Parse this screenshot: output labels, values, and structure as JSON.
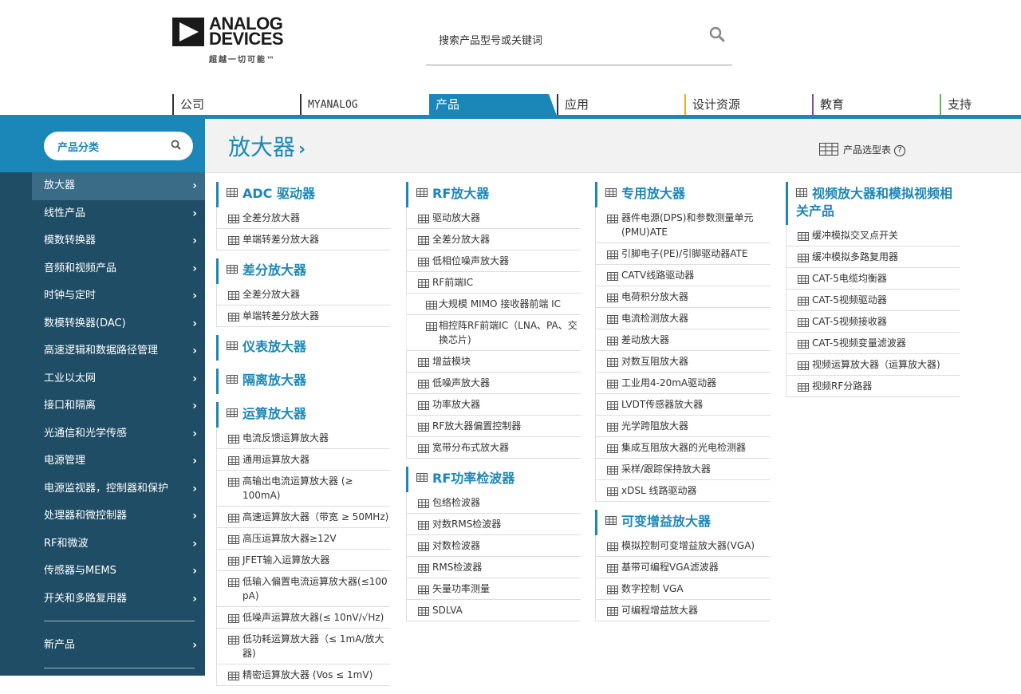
{
  "brand": {
    "line1": "ANALOG",
    "line2": "DEVICES",
    "tagline": "超越一切可能™"
  },
  "search": {
    "placeholder": "搜索产品型号或关键词"
  },
  "topnav": [
    {
      "label": "公司",
      "color": "#333333"
    },
    {
      "label": "MYANALOG",
      "color": "#333333"
    },
    {
      "label": "产品",
      "color": "#1b87b8",
      "active": true
    },
    {
      "label": "应用",
      "color": "#333333"
    },
    {
      "label": "设计资源",
      "color": "#f5a623"
    },
    {
      "label": "教育",
      "color": "#7b4fa0"
    },
    {
      "label": "支持",
      "color": "#5cb85c"
    }
  ],
  "sidebar": {
    "category_label": "产品分类",
    "items": [
      {
        "label": "放大器",
        "active": true
      },
      {
        "label": "线性产品"
      },
      {
        "label": "模数转换器"
      },
      {
        "label": "音频和视频产品"
      },
      {
        "label": "时钟与定时"
      },
      {
        "label": "数模转换器(DAC)"
      },
      {
        "label": "高速逻辑和数据路径管理"
      },
      {
        "label": "工业以太网"
      },
      {
        "label": "接口和隔离"
      },
      {
        "label": "光通信和光学传感"
      },
      {
        "label": "电源管理"
      },
      {
        "label": "电源监视器，控制器和保护"
      },
      {
        "label": "处理器和微控制器"
      },
      {
        "label": "RF和微波"
      },
      {
        "label": "传感器与MEMS"
      },
      {
        "label": "开关和多路复用器"
      }
    ],
    "new_products": "新产品"
  },
  "main": {
    "title": "放大器",
    "selector_label": "产品选型表",
    "help_glyph": "?",
    "columns": [
      [
        {
          "title": "ADC 驱动器",
          "items": [
            "全差分放大器",
            "单端转差分放大器"
          ]
        },
        {
          "title": "差分放大器",
          "items": [
            "全差分放大器",
            "单端转差分放大器"
          ]
        },
        {
          "title": "仪表放大器",
          "items": []
        },
        {
          "title": "隔离放大器",
          "items": []
        },
        {
          "title": "运算放大器",
          "items": [
            "电流反馈运算放大器",
            "通用运算放大器",
            "高输出电流运算放大器 (≥ 100mA)",
            "高速运算放大器（带宽 ≥ 50MHz)",
            "高压运算放大器≥12V",
            "JFET输入运算放大器",
            "低输入偏置电流运算放大器(≤100 pA)",
            "低噪声运算放大器(≤ 10nV/√Hz)",
            "低功耗运算放大器（≤ 1mA/放大器)",
            "精密运算放大器 (Vos ≤ 1mV)"
          ]
        }
      ],
      [
        {
          "title": "RF放大器",
          "items": [
            "驱动放大器",
            "全差分放大器",
            "低相位噪声放大器",
            "RF前端IC"
          ],
          "subitems": [
            "大规模 MIMO 接收器前端 IC",
            "相控阵RF前端IC（LNA、PA、交换芯片)"
          ],
          "items_after": [
            "增益模块",
            "低噪声放大器",
            "功率放大器",
            "RF放大器偏置控制器",
            "宽带分布式放大器"
          ]
        },
        {
          "title": "RF功率检波器",
          "items": [
            "包络检波器",
            "对数RMS检波器",
            "对数检波器",
            "RMS检波器",
            "矢量功率测量",
            "SDLVA"
          ]
        }
      ],
      [
        {
          "title": "专用放大器",
          "items": [
            "器件电源(DPS)和参数测量单元(PMU)ATE",
            "引脚电子(PE)/引脚驱动器ATE",
            "CATV线路驱动器",
            "电荷积分放大器",
            "电流检测放大器",
            "差动放大器",
            "对数互阻放大器",
            "工业用4-20mA驱动器",
            "LVDT传感器放大器",
            "光学跨阻放大器",
            "集成互阻放大器的光电检测器",
            "采样/跟踪保持放大器",
            "xDSL 线路驱动器"
          ]
        },
        {
          "title": "可变增益放大器",
          "items": [
            "模拟控制可变增益放大器(VGA)",
            "基带可编程VGA滤波器",
            "数字控制 VGA",
            "可编程增益放大器"
          ]
        }
      ],
      [
        {
          "title": "视频放大器和模拟视频相关产品",
          "items": [
            "缓冲模拟交叉点开关",
            "缓冲模拟多路复用器",
            "CAT-5电缆均衡器",
            "CAT-5视频驱动器",
            "CAT-5视频接收器",
            "CAT-5视频变量滤波器",
            "视频运算放大器（运算放大器)",
            "视频RF分路器"
          ]
        }
      ]
    ]
  }
}
